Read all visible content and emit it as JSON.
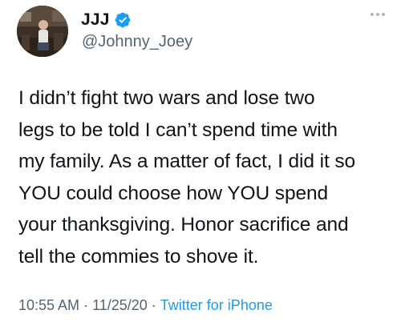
{
  "author": {
    "display_name": "JJJ",
    "handle": "@Johnny_Joey",
    "verified_icon": "verified-badge-icon",
    "avatar_icon": "profile-photo"
  },
  "more_icon": "more-options-icon",
  "tweet": {
    "text": "I didn’t fight two wars and lose two\nlegs to be told I can’t spend time with\nmy family. As a matter of fact, I did it so\nYOU could choose how YOU spend\nyour thanksgiving. Honor sacrifice and\ntell the commies to shove it."
  },
  "meta": {
    "time": "10:55 AM",
    "date": "11/25/20",
    "separator": "·",
    "source": "Twitter for iPhone"
  },
  "colors": {
    "text": "#0f1419",
    "secondary": "#536471",
    "link": "#1d9bf0",
    "verified": "#1d9bf0"
  }
}
